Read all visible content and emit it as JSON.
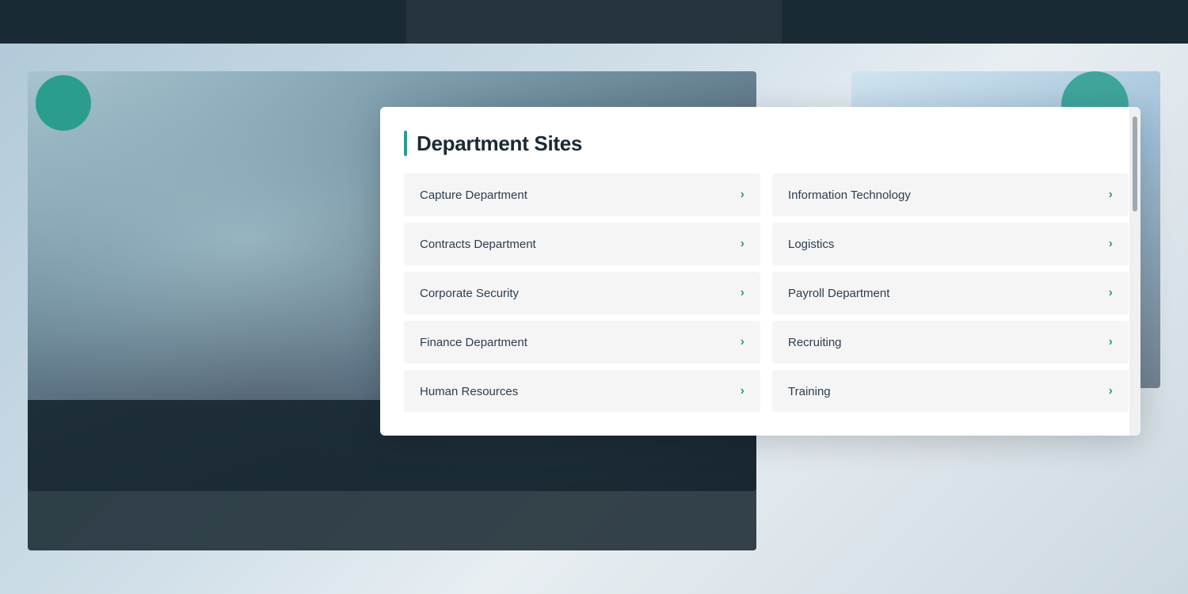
{
  "background": {
    "topBarColor": "#1a2a35"
  },
  "modal": {
    "title": "Department Sites",
    "titleBarColor": "#2a9d8f",
    "leftColumn": [
      {
        "id": "capture-department",
        "label": "Capture Department"
      },
      {
        "id": "contracts-department",
        "label": "Contracts Department"
      },
      {
        "id": "corporate-security",
        "label": "Corporate Security"
      },
      {
        "id": "finance-department",
        "label": "Finance Department"
      },
      {
        "id": "human-resources",
        "label": "Human Resources"
      }
    ],
    "rightColumn": [
      {
        "id": "information-technology",
        "label": "Information Technology"
      },
      {
        "id": "logistics",
        "label": "Logistics"
      },
      {
        "id": "payroll-department",
        "label": "Payroll Department"
      },
      {
        "id": "recruiting",
        "label": "Recruiting"
      },
      {
        "id": "training",
        "label": "Training"
      }
    ],
    "arrowChar": "›"
  }
}
